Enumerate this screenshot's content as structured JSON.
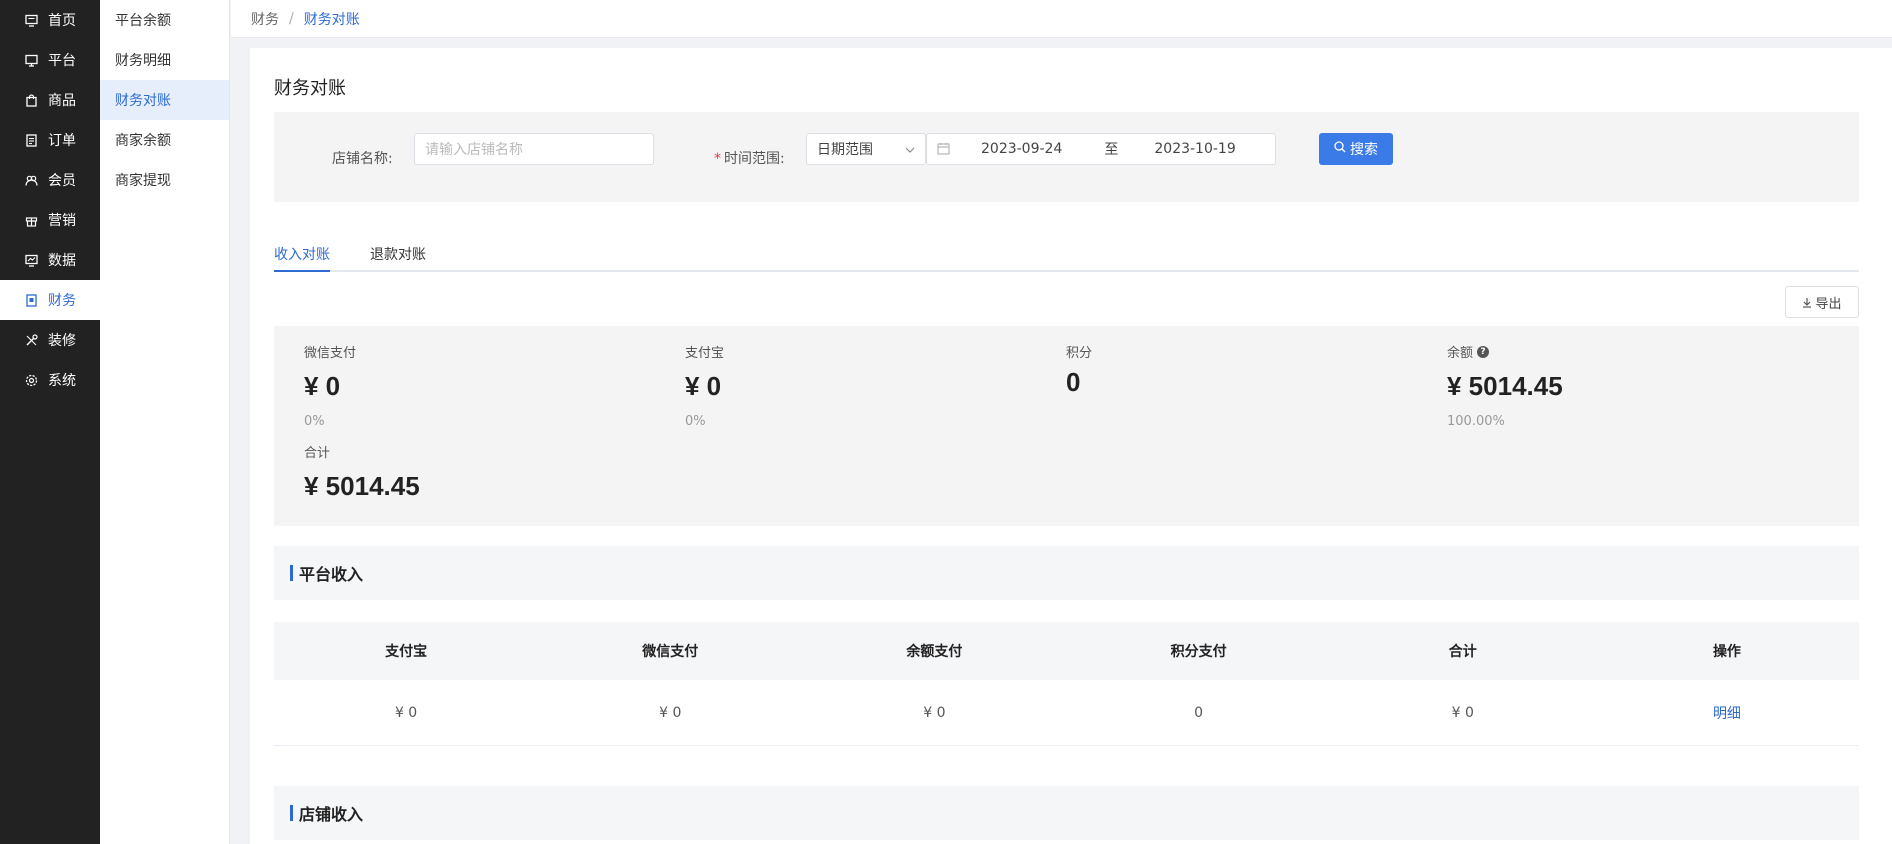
{
  "nav": {
    "items": [
      {
        "label": "首页",
        "icon": "home-icon"
      },
      {
        "label": "平台",
        "icon": "monitor-icon"
      },
      {
        "label": "商品",
        "icon": "bag-icon"
      },
      {
        "label": "订单",
        "icon": "document-icon"
      },
      {
        "label": "会员",
        "icon": "users-icon"
      },
      {
        "label": "营销",
        "icon": "gift-icon"
      },
      {
        "label": "数据",
        "icon": "chart-icon"
      },
      {
        "label": "财务",
        "icon": "finance-icon",
        "active": true
      },
      {
        "label": "装修",
        "icon": "tools-icon"
      },
      {
        "label": "系统",
        "icon": "gear-icon"
      }
    ]
  },
  "submenu": {
    "items": [
      "平台余额",
      "财务明细",
      "财务对账",
      "商家余额",
      "商家提现"
    ],
    "active_index": 2
  },
  "breadcrumb": {
    "parent": "财务",
    "separator": "/",
    "current": "财务对账"
  },
  "page": {
    "title": "财务对账"
  },
  "filter": {
    "shop_label": "店铺名称:",
    "shop_placeholder": "请输入店铺名称",
    "required_mark": "*",
    "time_label": "时间范围:",
    "range_type": "日期范围",
    "start_date": "2023-09-24",
    "range_to": "至",
    "end_date": "2023-10-19",
    "search_label": "搜索"
  },
  "tabs": {
    "income": "收入对账",
    "refund": "退款对账"
  },
  "export_label": "导出",
  "summary": {
    "wechat": {
      "label": "微信支付",
      "value": "¥ 0",
      "pct": "0%"
    },
    "alipay": {
      "label": "支付宝",
      "value": "¥ 0",
      "pct": "0%"
    },
    "points": {
      "label": "积分",
      "value": "0"
    },
    "balance": {
      "label": "余额",
      "value": "¥ 5014.45",
      "pct": "100.00%",
      "help": "?"
    },
    "total": {
      "label": "合计",
      "value": "¥ 5014.45"
    }
  },
  "platform_section": {
    "title": "平台收入",
    "columns": [
      "支付宝",
      "微信支付",
      "余额支付",
      "积分支付",
      "合计",
      "操作"
    ],
    "row": {
      "alipay": "¥ 0",
      "wechat": "¥ 0",
      "balance": "¥ 0",
      "points": "0",
      "total": "¥ 0",
      "action": "明细"
    }
  },
  "shop_section": {
    "title": "店铺收入"
  },
  "colors": {
    "accent": "#2d6bd1",
    "nav_bg": "#222222",
    "button": "#3b7be8"
  }
}
